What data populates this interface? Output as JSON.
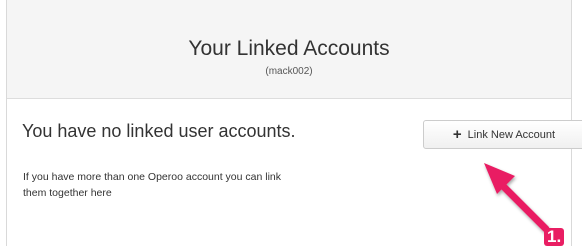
{
  "header": {
    "title": "Your Linked Accounts",
    "username": "(mack002)"
  },
  "content": {
    "empty_message": "You have no linked user accounts.",
    "help_text": "If you have more than one Operoo account you can link them together here"
  },
  "actions": {
    "link_button_label": "Link New Account",
    "link_button_icon": "plus-icon"
  },
  "annotation": {
    "step_label": "1.",
    "color": "#e91e63"
  }
}
